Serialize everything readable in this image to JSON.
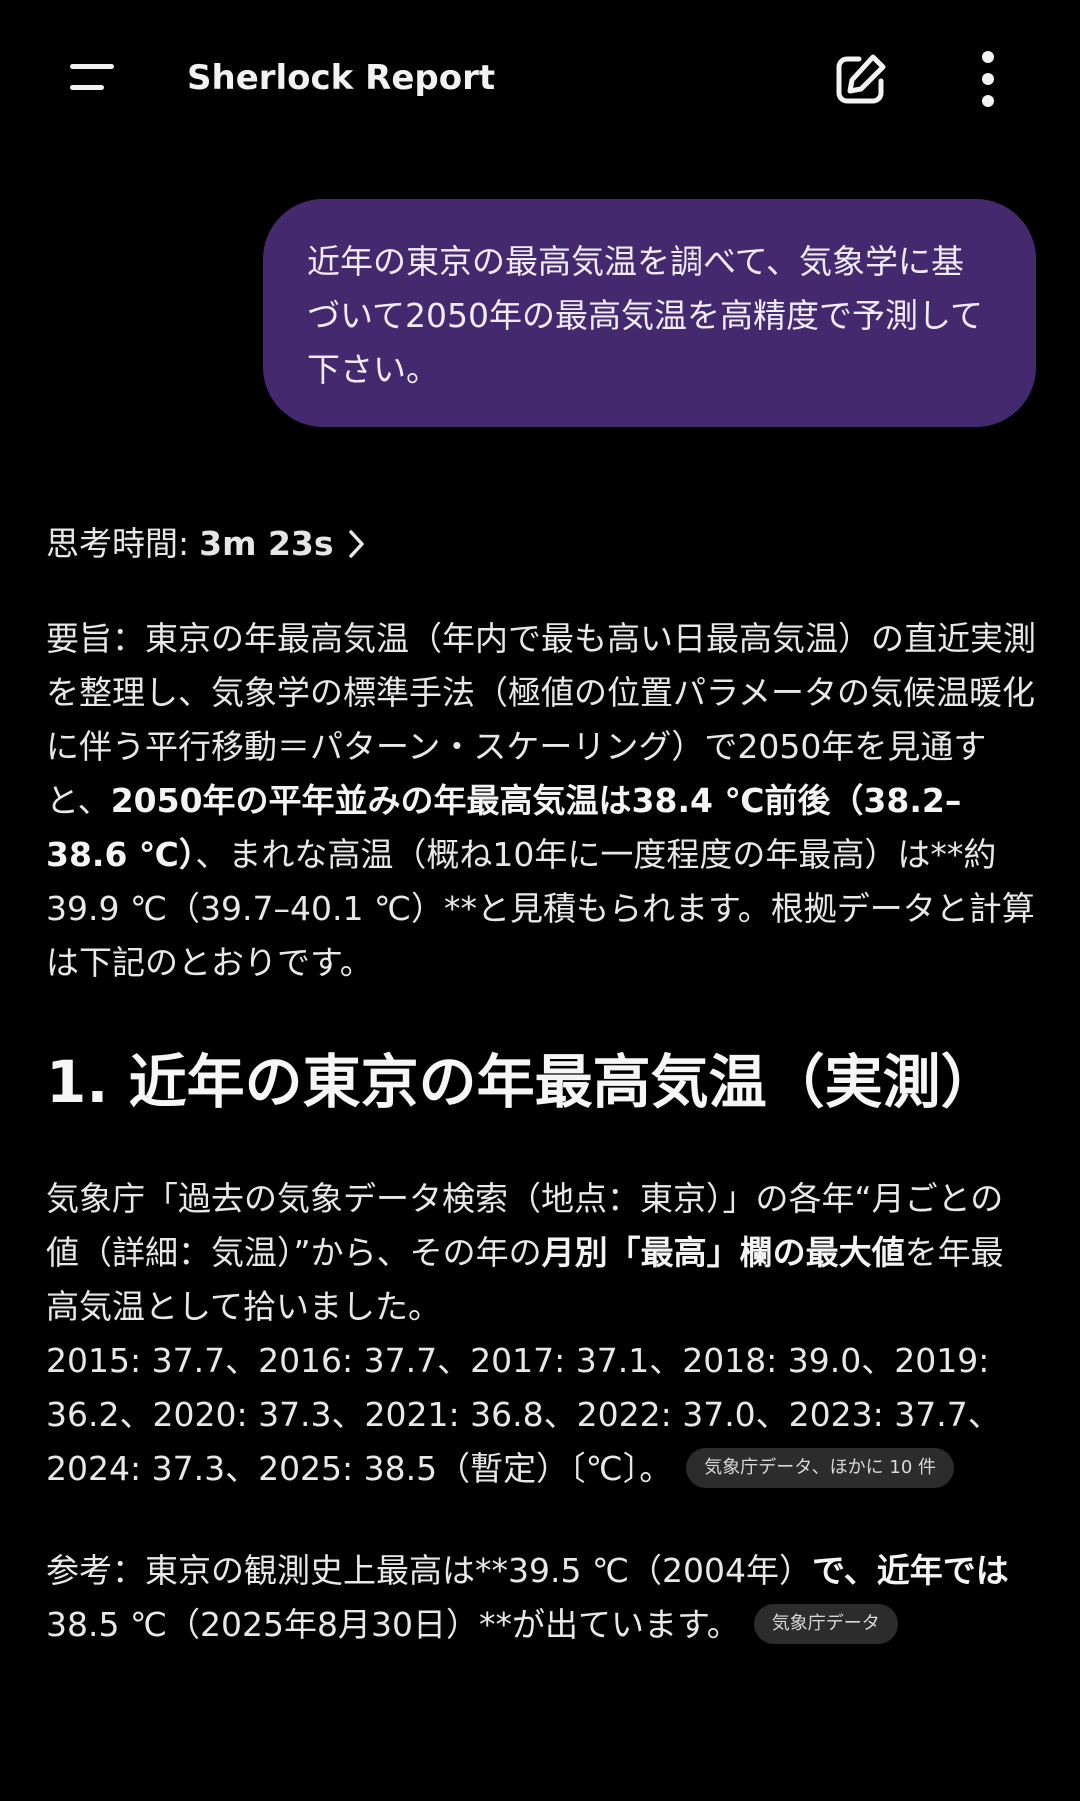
{
  "app": {
    "title": "Sherlock Report"
  },
  "colors": {
    "background": "#000000",
    "user_bubble": "#44296f",
    "chip": "#2c2c2c",
    "text": "#e8e8e8"
  },
  "icons": {
    "menu": "menu-icon",
    "compose": "compose-icon",
    "more": "more-vert-icon",
    "chevron": "chevron-right-icon"
  },
  "user_message": {
    "text": "近年の東京の最高気温を調べて、気象学に基づいて2050年の最高気温を高精度で予測して下さい。"
  },
  "thinking": {
    "label": "思考時間: ",
    "time": "3m 23s"
  },
  "summary": {
    "part1": "要旨：東京の年最高気温（年内で最も高い日最高気温）の直近実測を整理し、気象学の標準手法（極値の位置パラメータの気候温暖化に伴う平行移動＝パターン・スケーリング）で2050年を見通すと、",
    "bold1": "2050年の平年並みの年最高気温は38.4 ℃前後（38.2–38.6 ℃）",
    "part2": "、まれな高温（概ね10年に一度程度の年最高）は**約39.9 ℃（39.7–40.1 ℃）**と見積もられます。根拠データと計算は下記のとおりです。"
  },
  "section1": {
    "heading": "1. 近年の東京の年最高気温（実測）",
    "p1_part1": "気象庁「過去の気象データ検索（地点：東京）」の各年“月ごとの値（詳細：気温）”から、その年の",
    "p1_bold": "月別「最高」欄の最大値",
    "p1_part2": "を年最高気温として拾いました。",
    "p1_data": "2015: 37.7、2016: 37.7、2017: 37.1、2018: 39.0、2019: 36.2、2020: 37.3、2021: 36.8、2022: 37.0、2023: 37.7、2024: 37.3、2025: 38.5（暫定）〔℃〕。",
    "p1_chip": "気象庁データ、ほかに 10 件",
    "p2_part1": "参考：東京の観測史上最高は**39.5 ℃（2004年）",
    "p2_bold": "で、近年では",
    "p2_part2": "38.5 ℃（2025年8月30日）**が出ています。",
    "p2_chip": "気象庁データ"
  }
}
